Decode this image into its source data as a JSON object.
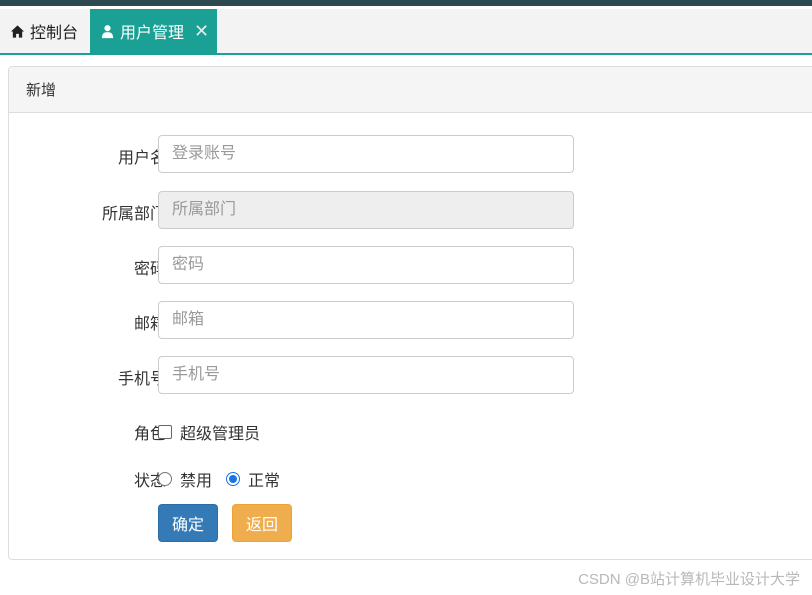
{
  "tabs": [
    {
      "label": "控制台",
      "icon": "home-icon",
      "active": false
    },
    {
      "label": "用户管理",
      "icon": "user-icon",
      "active": true,
      "closable": true
    }
  ],
  "colors": {
    "top_stripe": "#2c4a50",
    "tab_active": "#1aa094",
    "btn_primary": "#337ab7",
    "btn_warning": "#f0ad4e",
    "radio_checked": "#1a73e8"
  },
  "panel": {
    "title": "新增"
  },
  "form": {
    "username": {
      "label": "用户名",
      "placeholder": "登录账号"
    },
    "department": {
      "label": "所属部门",
      "placeholder": "所属部门",
      "disabled": true
    },
    "password": {
      "label": "密码",
      "placeholder": "密码"
    },
    "email": {
      "label": "邮箱",
      "placeholder": "邮箱"
    },
    "phone": {
      "label": "手机号",
      "placeholder": "手机号"
    },
    "role": {
      "label": "角色",
      "option": "超级管理员",
      "checked": false
    },
    "status": {
      "label": "状态",
      "options": [
        "禁用",
        "正常"
      ],
      "selected": "正常"
    }
  },
  "buttons": {
    "confirm": "确定",
    "back": "返回"
  },
  "watermark": "CSDN @B站计算机毕业设计大学"
}
